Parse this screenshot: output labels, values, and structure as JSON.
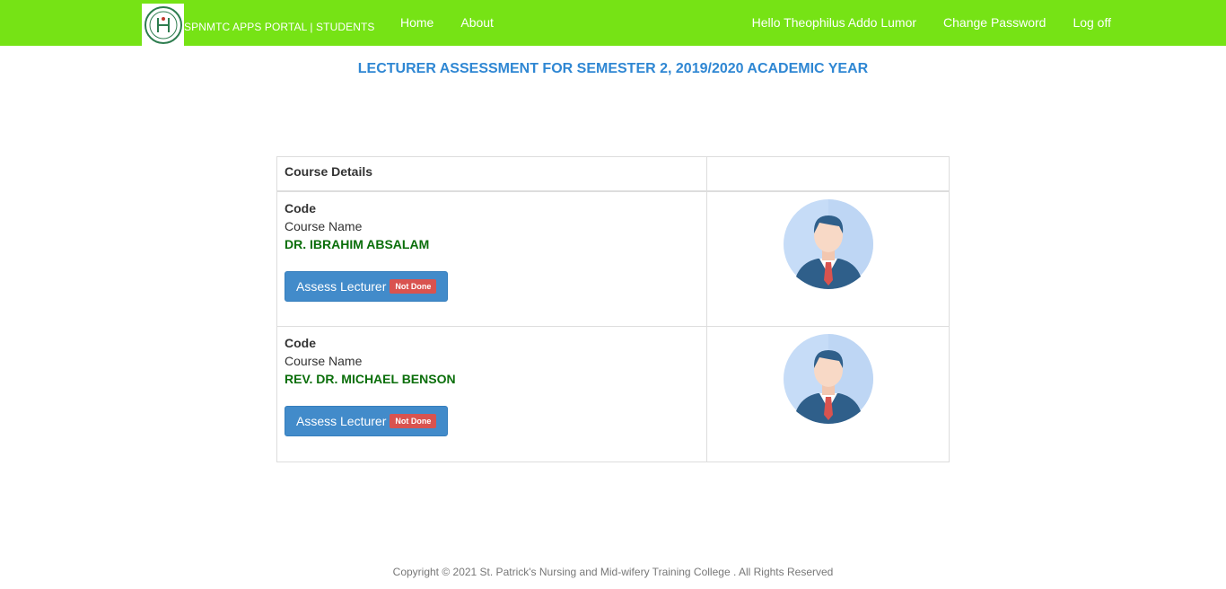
{
  "brand": {
    "title": "SPNMTC APPS PORTAL | STUDENTS",
    "logo": "college-crest-logo"
  },
  "nav": {
    "left": [
      "Home",
      "About"
    ],
    "greeting": "Hello Theophilus Addo Lumor",
    "change_password": "Change Password",
    "logout": "Log off"
  },
  "page_title": "LECTURER ASSESSMENT FOR SEMESTER 2, 2019/2020 ACADEMIC YEAR",
  "table": {
    "header": "Course Details",
    "rows": [
      {
        "code": "Code",
        "course_name": "Course Name",
        "lecturer": "DR. IBRAHIM ABSALAM",
        "button": "Assess Lecturer",
        "status": "Not Done",
        "avatar": "person-avatar-icon"
      },
      {
        "code": "Code",
        "course_name": "Course Name",
        "lecturer": "REV. DR. MICHAEL BENSON",
        "button": "Assess Lecturer",
        "status": "Not Done",
        "avatar": "person-avatar-icon"
      }
    ]
  },
  "colors": {
    "navbar": "#76e315",
    "title": "#2f87d3",
    "lecturer": "#0a6e0a",
    "button": "#428bca",
    "badge": "#d9534f"
  },
  "footer": "Copyright © 2021 St. Patrick's Nursing and Mid-wifery Training College . All Rights Reserved"
}
